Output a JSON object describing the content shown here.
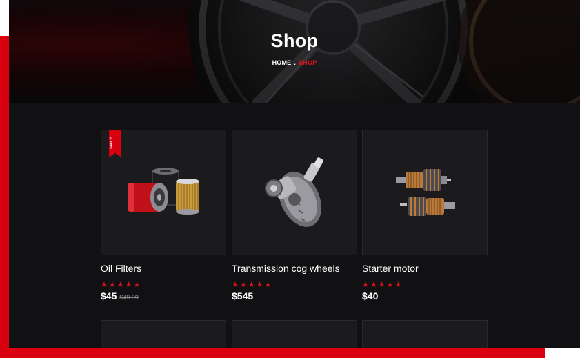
{
  "hero": {
    "title": "Shop",
    "breadcrumb": {
      "home": "HOME",
      "separator": ".",
      "current": "SHOP"
    }
  },
  "products": [
    {
      "name": "Oil Filters",
      "rating": 5,
      "stars": "★★★★★",
      "price": "$45",
      "old_price": "$49.99",
      "badge": "SALE",
      "icon": "oil-filters-image"
    },
    {
      "name": "Transmission cog wheels",
      "rating": 5,
      "stars": "★★★★★",
      "price": "$545",
      "icon": "cog-wheels-image"
    },
    {
      "name": "Starter motor",
      "rating": 5,
      "stars": "★★★★★",
      "price": "$40",
      "icon": "starter-motor-image"
    }
  ],
  "colors": {
    "accent": "#e0111d",
    "background": "#111114",
    "card": "#1b1b1d"
  }
}
